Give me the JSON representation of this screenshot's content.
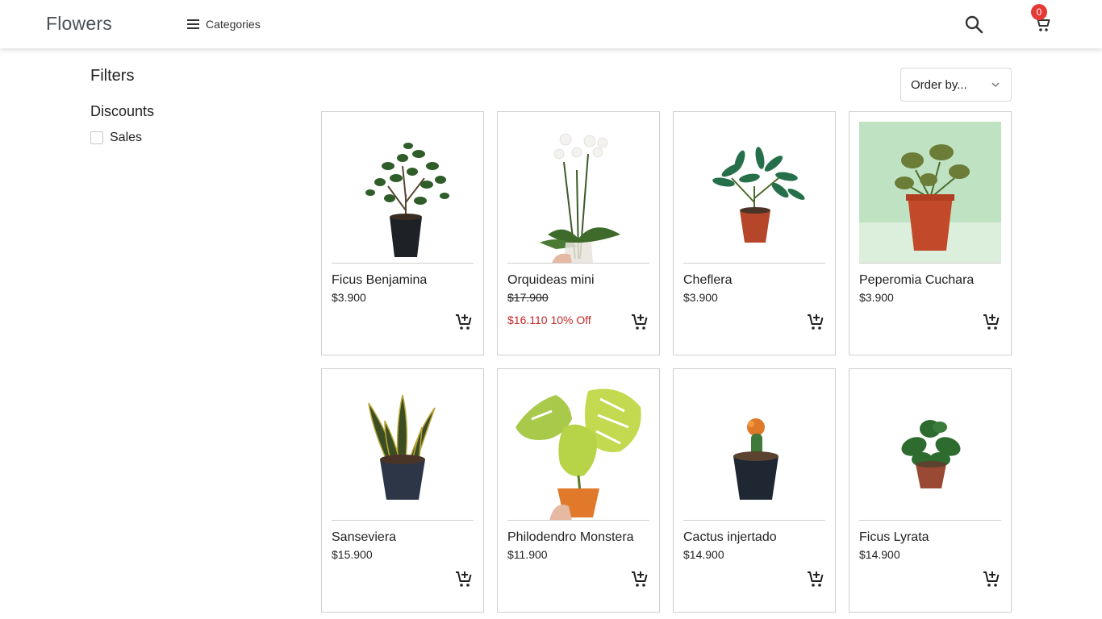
{
  "header": {
    "brand": "Flowers",
    "categories_label": "Categories",
    "cart_count": "0"
  },
  "filters": {
    "title": "Filters",
    "discounts_title": "Discounts",
    "sales_label": "Sales"
  },
  "sort": {
    "label": "Order by..."
  },
  "colors": {
    "sale_red": "#c62828",
    "badge_red": "#e53935",
    "leaf_green": "#2e6b2f",
    "pot_terracotta": "#b5462a",
    "pot_dark": "#222a33"
  },
  "products": [
    {
      "name": "Ficus Benjamina",
      "price": "$3.900",
      "image": "ficus-benjamina-plant"
    },
    {
      "name": "Orquideas mini",
      "old_price": "$17.900",
      "price": "$16.110 10% Off",
      "image": "orchid-plant"
    },
    {
      "name": "Cheflera",
      "price": "$3.900",
      "image": "cheflera-plant"
    },
    {
      "name": "Peperomia Cuchara",
      "price": "$3.900",
      "image": "peperomia-plant"
    },
    {
      "name": "Sanseviera",
      "price": "$15.900",
      "image": "sanseviera-plant"
    },
    {
      "name": "Philodendro Monstera",
      "price": "$11.900",
      "image": "monstera-plant"
    },
    {
      "name": "Cactus injertado",
      "price": "$14.900",
      "image": "grafted-cactus-plant"
    },
    {
      "name": "Ficus Lyrata",
      "price": "$14.900",
      "image": "ficus-lyrata-plant"
    }
  ]
}
